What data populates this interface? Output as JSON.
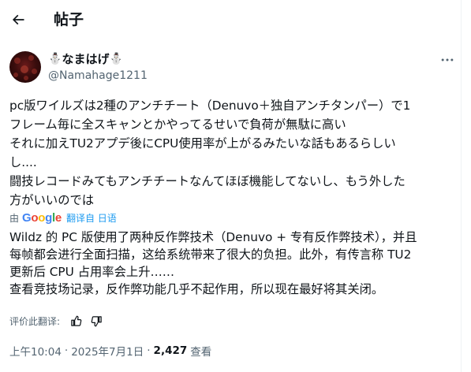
{
  "header": {
    "back_icon": "arrow-left-icon",
    "title": "帖子"
  },
  "author": {
    "display_name_prefix": "⛄",
    "display_name": "なまはげ",
    "display_name_suffix": "⛄",
    "handle": "@Namahage1211",
    "more_icon": "more-horizontal-icon"
  },
  "tweet": {
    "lines": [
      "pc版ワイルズは2種のアンチチート（Denuvo＋独自アンチタンパー）で1",
      "フレーム毎に全スキャンとかやってるせいで負荷が無駄に高い",
      "それに加えTU2アプデ後にCPU使用率が上がるみたいな話もあるらしい",
      "し....",
      "闘技レコードみてもアンチチートなんてほぼ機能してないし、もう外した",
      "方がいいのでは"
    ]
  },
  "translation": {
    "by_label": "由",
    "provider": "Google",
    "translated_from": "翻译自 日语",
    "lines": [
      "Wildz 的 PC 版使用了两种反作弊技术（Denuvo + 专有反作弊技术），并且",
      "每帧都会进行全面扫描，这给系统带来了很大的负担。此外，有传言称 TU2",
      "更新后 CPU 占用率会上升……",
      "查看竞技场记录，反作弊功能几乎不起作用，所以现在最好将其关闭。"
    ],
    "rate_label": "评价此翻译:",
    "thumbs_up_icon": "thumbs-up-icon",
    "thumbs_down_icon": "thumbs-down-icon"
  },
  "meta": {
    "time": "上午10:04",
    "separator": "·",
    "date": "2025年7月1日",
    "views_count": "2,427",
    "views_label": "查看"
  },
  "colors": {
    "text": "#0f1419",
    "secondary": "#536471",
    "link": "#1d9bf0"
  }
}
